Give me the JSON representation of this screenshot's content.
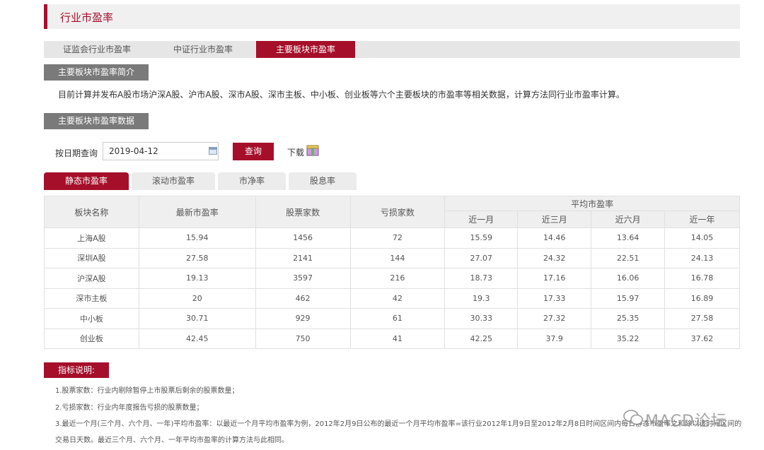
{
  "header": {
    "title": "行业市盈率"
  },
  "tabs": [
    "证监会行业市盈率",
    "中证行业市盈率",
    "主要板块市盈率"
  ],
  "intro_section": {
    "heading": "主要板块市盈率简介",
    "text": "目前计算并发布A股市场沪深A股、沪市A股、深市A股、深市主板、中小板、创业板等六个主要板块的市盈率等相关数据，计算方法同行业市盈率计算。"
  },
  "data_section": {
    "heading": "主要板块市盈率数据"
  },
  "query": {
    "label": "按日期查询",
    "date": "2019-04-12",
    "button": "查询",
    "download": "下载"
  },
  "subtabs": [
    "静态市盈率",
    "滚动市盈率",
    "市净率",
    "股息率"
  ],
  "table": {
    "headers": [
      "板块名称",
      "最新市盈率",
      "股票家数",
      "亏损家数",
      "平均市盈率"
    ],
    "subheaders": [
      "近一月",
      "近三月",
      "近六月",
      "近一年"
    ],
    "rows": [
      [
        "上海A股",
        "15.94",
        "1456",
        "72",
        "15.59",
        "14.46",
        "13.64",
        "14.05"
      ],
      [
        "深圳A股",
        "27.58",
        "2141",
        "144",
        "27.07",
        "24.32",
        "22.51",
        "24.13"
      ],
      [
        "沪深A股",
        "19.13",
        "3597",
        "216",
        "18.73",
        "17.16",
        "16.06",
        "16.78"
      ],
      [
        "深市主板",
        "20",
        "462",
        "42",
        "19.3",
        "17.33",
        "15.97",
        "16.89"
      ],
      [
        "中小板",
        "30.71",
        "929",
        "61",
        "30.33",
        "27.32",
        "25.35",
        "27.58"
      ],
      [
        "创业板",
        "42.45",
        "750",
        "41",
        "42.25",
        "37.9",
        "35.22",
        "37.62"
      ]
    ]
  },
  "legend": {
    "heading": "指标说明:",
    "notes": [
      "1.股票家数：行业内剔除暂停上市股票后剩余的股票数量；",
      "2.亏损家数：行业内年度报告亏损的股票数量；",
      "3.最近一个月(三个月、六个月、一年)平均市盈率：以最近一个月平均市盈率为例，2012年2月9日公布的最近一个月平均市盈率=该行业2012年1月9日至2012年2月8日时间区间内每日静态市盈率之和除以该时间区间的",
      "交易日天数。最近三个月、六个月、一年平均市盈率的计算方法与此相同。"
    ]
  },
  "watermark": "MACD论坛",
  "colors": {
    "accent": "#a50f2a",
    "section_gray": "#7a7a7a"
  }
}
